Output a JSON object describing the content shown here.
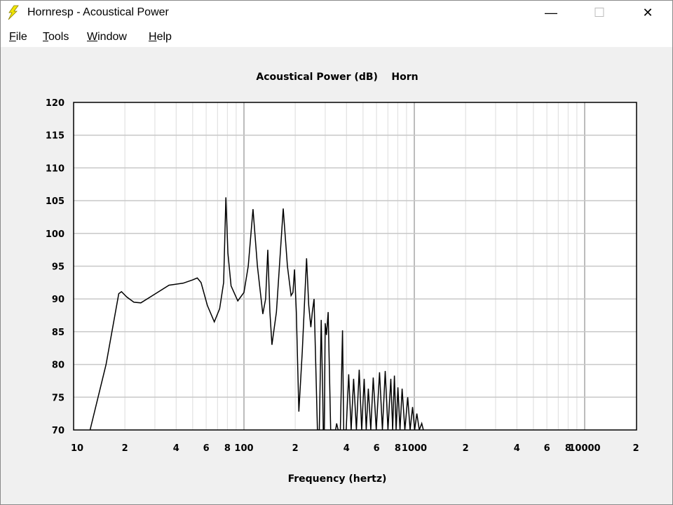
{
  "window": {
    "title": "Hornresp - Acoustical Power",
    "minimize": "—",
    "maximize": "☐",
    "close": "✕",
    "icon": "lightning-bolt-icon"
  },
  "menu": [
    {
      "label": "File",
      "key": "F",
      "rest": "ile"
    },
    {
      "label": "Tools",
      "key": "T",
      "rest": "ools"
    },
    {
      "label": "Window",
      "key": "W",
      "rest": "indow"
    },
    {
      "label": "Help",
      "key": "H",
      "rest": "elp"
    }
  ],
  "chart_data": {
    "type": "line",
    "title": "Acoustical Power (dB)    Horn",
    "xlabel": "Frequency (hertz)",
    "ylabel": "",
    "xscale": "log",
    "xlim": [
      10,
      20000
    ],
    "ylim": [
      70,
      120
    ],
    "yticks": [
      70,
      75,
      80,
      85,
      90,
      95,
      100,
      105,
      110,
      115,
      120
    ],
    "xtick_values": [
      10,
      20,
      40,
      60,
      80,
      100,
      200,
      400,
      600,
      800,
      1000,
      2000,
      4000,
      6000,
      8000,
      10000,
      20000
    ],
    "xtick_labels": [
      "10",
      "2",
      "4",
      "6",
      "8",
      "100",
      "2",
      "4",
      "6",
      "8",
      "1000",
      "2",
      "4",
      "6",
      "8",
      "10000",
      "2"
    ],
    "grid": true,
    "line_color": "#000000",
    "grid_color": "#c8c8c8",
    "series": [
      {
        "points": [
          [
            12.5,
            70
          ],
          [
            15.5,
            80
          ],
          [
            18.4,
            90.8
          ],
          [
            19.1,
            91.1
          ],
          [
            20.5,
            90.3
          ],
          [
            22.6,
            89.5
          ],
          [
            24.8,
            89.4
          ],
          [
            29,
            90.5
          ],
          [
            36.3,
            92.1
          ],
          [
            43.9,
            92.4
          ],
          [
            50,
            92.9
          ],
          [
            53.2,
            93.2
          ],
          [
            56,
            92.5
          ],
          [
            61,
            89
          ],
          [
            67,
            86.5
          ],
          [
            72,
            88.5
          ],
          [
            76,
            92.5
          ],
          [
            78.3,
            105.5
          ],
          [
            80.5,
            97
          ],
          [
            84,
            92
          ],
          [
            92,
            89.7
          ],
          [
            100,
            91
          ],
          [
            106,
            95
          ],
          [
            113,
            103.7
          ],
          [
            120,
            95
          ],
          [
            129,
            87.7
          ],
          [
            134,
            90
          ],
          [
            138,
            97.5
          ],
          [
            142,
            88
          ],
          [
            146,
            83
          ],
          [
            155,
            88
          ],
          [
            170,
            103.8
          ],
          [
            180,
            95
          ],
          [
            189,
            90.5
          ],
          [
            194,
            91
          ],
          [
            198,
            94.5
          ],
          [
            203,
            88
          ],
          [
            210,
            72.8
          ],
          [
            220,
            82
          ],
          [
            233,
            96.2
          ],
          [
            240,
            89
          ],
          [
            247,
            85.7
          ],
          [
            252,
            88
          ],
          [
            258,
            90
          ],
          [
            264,
            80
          ],
          [
            270,
            70
          ],
          [
            277,
            70
          ],
          [
            284,
            86.8
          ],
          [
            290,
            75
          ],
          [
            292,
            70
          ],
          [
            296,
            70
          ],
          [
            300,
            86.3
          ],
          [
            305,
            84.5
          ],
          [
            312,
            88
          ],
          [
            318,
            78
          ],
          [
            323,
            70
          ],
          [
            345,
            70
          ],
          [
            350,
            71
          ],
          [
            357,
            70
          ],
          [
            368,
            70
          ],
          [
            379,
            85.2
          ],
          [
            385,
            70
          ],
          [
            398,
            70
          ],
          [
            412,
            78.5
          ],
          [
            426,
            70
          ],
          [
            440,
            77.8
          ],
          [
            457,
            70
          ],
          [
            475,
            79.2
          ],
          [
            491,
            70
          ],
          [
            508,
            77.8
          ],
          [
            522,
            70
          ],
          [
            537,
            76.3
          ],
          [
            555,
            70
          ],
          [
            574,
            78
          ],
          [
            598,
            70
          ],
          [
            625,
            78.8
          ],
          [
            650,
            70
          ],
          [
            675,
            79
          ],
          [
            700,
            70
          ],
          [
            728,
            77.8
          ],
          [
            746,
            70
          ],
          [
            764,
            78.3
          ],
          [
            782,
            70
          ],
          [
            801,
            76.5
          ],
          [
            824,
            70
          ],
          [
            848,
            76.3
          ],
          [
            880,
            70
          ],
          [
            915,
            75
          ],
          [
            945,
            70
          ],
          [
            977,
            73.5
          ],
          [
            1005,
            70
          ],
          [
            1035,
            72.5
          ],
          [
            1070,
            70
          ],
          [
            1106,
            71
          ],
          [
            1130,
            70
          ]
        ]
      }
    ]
  }
}
